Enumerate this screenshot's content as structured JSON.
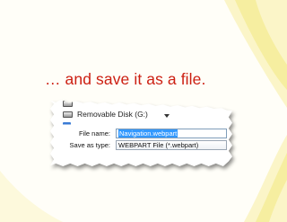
{
  "slide": {
    "caption": "… and save it as a file."
  },
  "dialog": {
    "tree_items": [
      {
        "label": "Removable Disk (G:)"
      }
    ],
    "file_name_label": "File name:",
    "file_name_value": "Navigation.webpart",
    "save_as_type_label": "Save as type:",
    "save_as_type_value": "WEBPART File (*.webpart)"
  },
  "colors": {
    "caption": "#cc1f12",
    "selection": "#3399ff",
    "swoosh": "#f6eea0"
  }
}
